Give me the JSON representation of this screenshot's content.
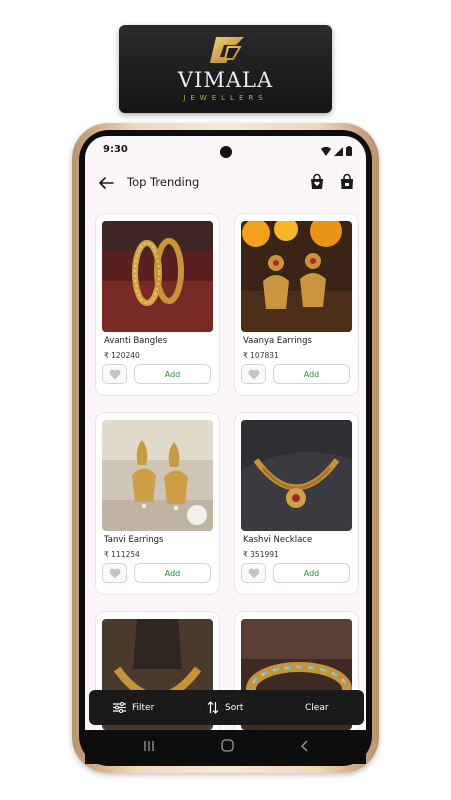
{
  "brand": {
    "name": "VIMALA",
    "tagline": "JEWELLERS"
  },
  "status_bar": {
    "time": "9:30"
  },
  "header": {
    "title": "Top Trending"
  },
  "products": [
    {
      "name": "Avanti Bangles",
      "price": "₹ 120240",
      "add_label": "Add"
    },
    {
      "name": "Vaanya Earrings",
      "price": "₹ 107831",
      "add_label": "Add"
    },
    {
      "name": "Tanvi Earrings",
      "price": "₹ 111254",
      "add_label": "Add"
    },
    {
      "name": "Kashvi Necklace",
      "price": "₹ 351991",
      "add_label": "Add"
    },
    {
      "name": "",
      "price": "",
      "add_label": ""
    },
    {
      "name": "",
      "price": "",
      "add_label": ""
    }
  ],
  "action_bar": {
    "filter_label": "Filter",
    "sort_label": "Sort",
    "clear_label": "Clear"
  },
  "colors": {
    "gold": "#c9a14a",
    "add_green": "#2f8b3a",
    "screen_bg": "#fbf6f9",
    "bar_dark": "#1a1a1a"
  },
  "icons": [
    "back-arrow-icon",
    "cart-icon",
    "shopping-bag-icon",
    "heart-icon",
    "filter-icon",
    "sort-icon",
    "wifi-icon",
    "signal-icon",
    "battery-icon",
    "recent-apps-icon",
    "home-icon",
    "nav-back-icon"
  ]
}
